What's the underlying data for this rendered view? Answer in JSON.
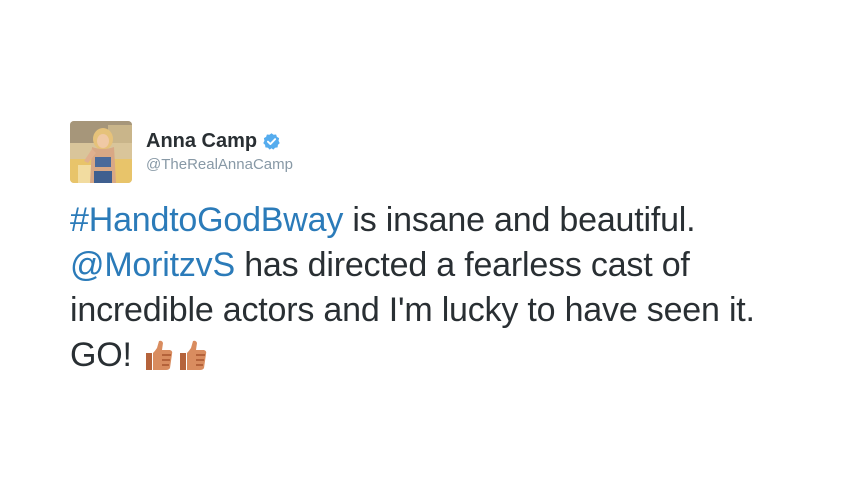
{
  "tweet": {
    "display_name": "Anna Camp",
    "handle": "@TheRealAnnaCamp",
    "verified": true,
    "verified_color": "#55acee",
    "hashtag": "#HandtoGodBway",
    "text_part1": " is insane and beautiful.",
    "mention": "@MoritzvS",
    "text_part2": " has directed a fearless cast of incredible actors and I'm lucky to have seen it. GO! ",
    "emoji": [
      "thumbs-up-icon",
      "thumbs-up-icon"
    ],
    "link_color": "#2b7bb9",
    "text_color": "#292f33"
  }
}
